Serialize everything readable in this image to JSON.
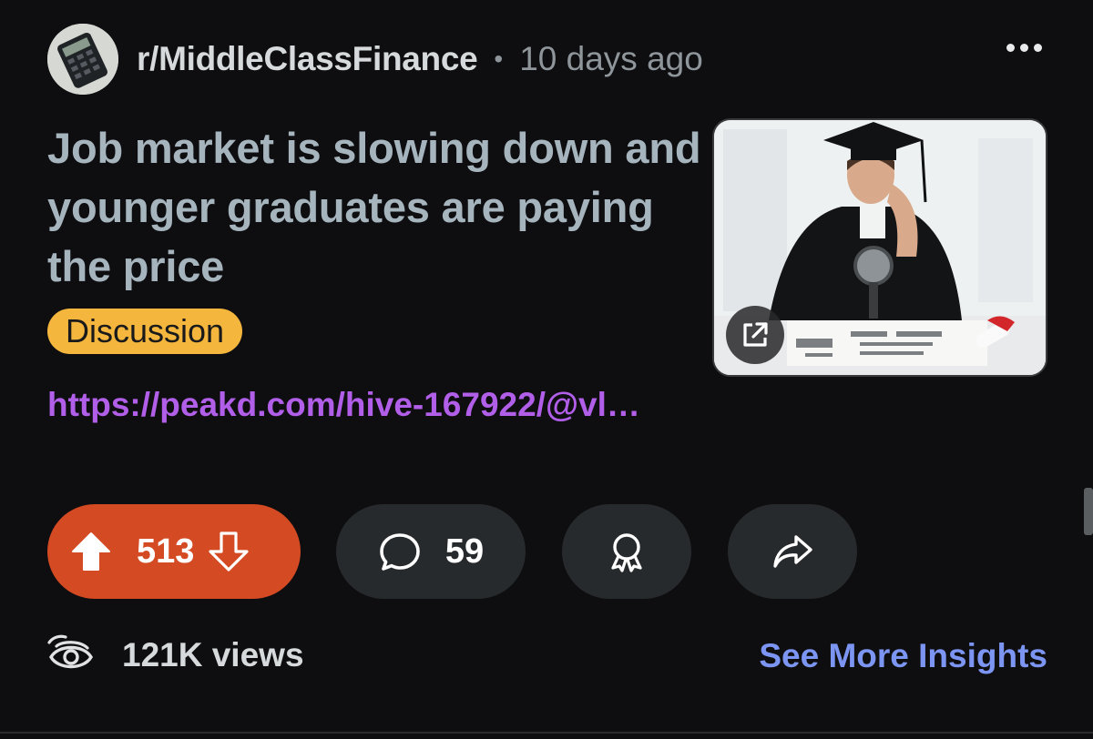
{
  "post": {
    "subreddit": "r/MiddleClassFinance",
    "separator": "•",
    "time_ago": "10 days ago",
    "title": "Job market is slowing down and younger graduates are paying the price",
    "flair": "Discussion",
    "link": "https://peakd.com/hive-167922/@vl…",
    "thumbnail_icon": "graduate-photo",
    "upvotes": "513",
    "comments": "59",
    "views": "121K views",
    "insights_label": "See More Insights"
  },
  "colors": {
    "background": "#0e0e10",
    "upvote_bg": "#d34a23",
    "flair_bg": "#f4b63d",
    "link": "#b15ee8",
    "insights": "#7c95f2",
    "title": "#a6b4be"
  }
}
